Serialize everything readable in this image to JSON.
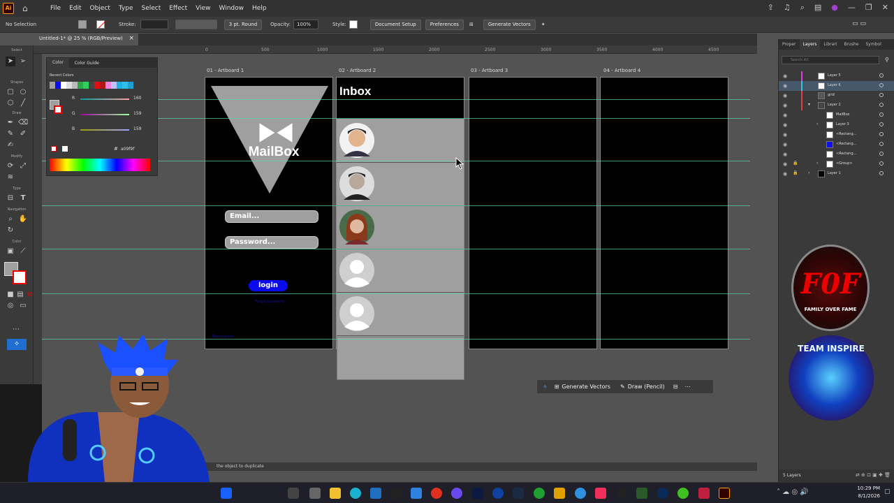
{
  "menubar": {
    "items": [
      "File",
      "Edit",
      "Object",
      "Type",
      "Select",
      "Effect",
      "View",
      "Window",
      "Help"
    ]
  },
  "controlbar": {
    "selection": "No Selection",
    "stroke_label": "Stroke:",
    "brush": "3 pt. Round",
    "opacity_label": "Opacity:",
    "opacity_value": "100%",
    "style_label": "Style:",
    "document_setup": "Document Setup",
    "preferences": "Preferences",
    "generate_vectors": "Generate Vectors"
  },
  "document": {
    "tab_title": "Untitled-1* @ 25 % (RGB/Preview)"
  },
  "tools": {
    "labels": [
      "Select",
      "Shapes",
      "Draw",
      "Modify",
      "Type",
      "Navigation",
      "Color"
    ]
  },
  "ruler": {
    "ticks": [
      "0",
      "500",
      "1000",
      "1500",
      "2000",
      "2500",
      "3000",
      "3500",
      "4000",
      "4500"
    ]
  },
  "color_panel": {
    "tab_color": "Color",
    "tab_guide": "Color Guide",
    "recent_label": "Recent Colors",
    "r_label": "R",
    "r_value": "160",
    "g_label": "G",
    "g_value": "159",
    "b_label": "B",
    "b_value": "159",
    "hex_label": "#",
    "hex_value": "a09f9f"
  },
  "artboards": [
    {
      "label": "01 - Artboard 1"
    },
    {
      "label": "02 - Artboard 2"
    },
    {
      "label": "03 - Artboard 3"
    },
    {
      "label": "04 - Artboard 4"
    }
  ],
  "mailbox": {
    "title": "MailBox",
    "email_placeholder": "Email...",
    "password_placeholder": "Password...",
    "login": "login",
    "forgot": "Forgot password",
    "register": "Reediegister"
  },
  "inbox": {
    "title": "Inbox"
  },
  "layers_panel": {
    "tabs": [
      "Proper",
      "Layers",
      "Librari",
      "Brushe",
      "Symbol"
    ],
    "active_tab": "Layers",
    "search_placeholder": "Search All",
    "rows": [
      {
        "name": "Layer 5"
      },
      {
        "name": "Layer 6"
      },
      {
        "name": "grid"
      },
      {
        "name": "Layer 2"
      },
      {
        "name": "MailBox"
      },
      {
        "name": "Layer 3"
      },
      {
        "name": "<Rectang..."
      },
      {
        "name": "<Rectang..."
      },
      {
        "name": "<Rectang..."
      },
      {
        "name": "<Group>"
      },
      {
        "name": "Layer 1"
      }
    ],
    "footer": "5 Layers"
  },
  "floatbar": {
    "generate_vectors": "Generate Vectors",
    "draw_pencil": "Draw (Pencil)"
  },
  "status": {
    "hint": "the object to duplicate"
  },
  "overlay": {
    "logo1": "FAMILY OVER FAME",
    "logo2": "TEAM INSPIRE"
  },
  "taskbar": {
    "time": "10:29 PM",
    "date": "8/1/2026"
  },
  "colors": {
    "guide": "#5fcfb4",
    "login_button": "#0a0aee",
    "fill_gray": "#a09f9f"
  }
}
